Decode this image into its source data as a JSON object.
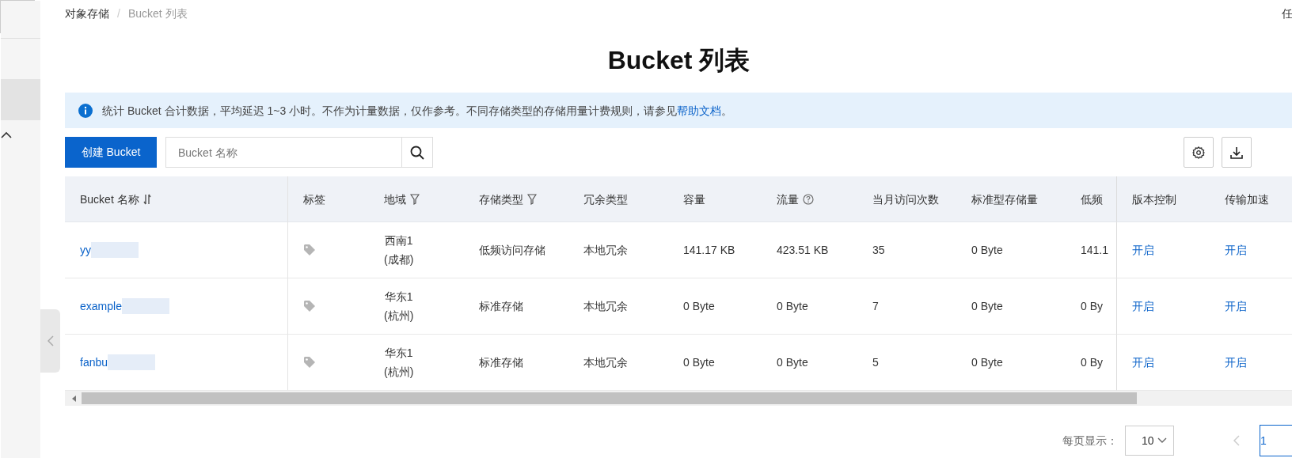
{
  "breadcrumb": {
    "items": [
      "对象存储",
      "Bucket 列表"
    ],
    "separator": "/"
  },
  "top_right_text": "任",
  "title": "Bucket 列表",
  "notice": {
    "text": "统计 Bucket 合计数据，平均延迟 1~3 小时。不作为计量数据，仅作参考。不同存储类型的存储用量计费规则，请参见",
    "link": "帮助文档",
    "suffix": "。"
  },
  "toolbar": {
    "create_button": "创建 Bucket",
    "search": {
      "placeholder": "Bucket 名称"
    }
  },
  "table": {
    "columns": [
      {
        "label": "Bucket 名称",
        "kind": "sortable"
      },
      {
        "label": "标签",
        "kind": "plain"
      },
      {
        "label": "地域",
        "kind": "filterable"
      },
      {
        "label": "存储类型",
        "kind": "filterable"
      },
      {
        "label": "冗余类型",
        "kind": "plain"
      },
      {
        "label": "容量",
        "kind": "plain"
      },
      {
        "label": "流量",
        "kind": "help"
      },
      {
        "label": "当月访问次数",
        "kind": "plain"
      },
      {
        "label": "标准型存储量",
        "kind": "plain"
      },
      {
        "label": "低频",
        "kind": "plain"
      },
      {
        "label": "版本控制",
        "kind": "plain"
      },
      {
        "label": "传输加速",
        "kind": "plain"
      }
    ],
    "rows": [
      {
        "name": "yy",
        "region": "西南1\n(成都)",
        "storage": "低频访问存储",
        "redundancy": "本地冗余",
        "capacity": "141.17 KB",
        "traffic": "423.51 KB",
        "visits": "35",
        "standard": "0 Byte",
        "low": "141.1",
        "versioning": "开启",
        "acceleration": "开启"
      },
      {
        "name": "example",
        "region": "华东1\n(杭州)",
        "storage": "标准存储",
        "redundancy": "本地冗余",
        "capacity": "0 Byte",
        "traffic": "0 Byte",
        "visits": "7",
        "standard": "0 Byte",
        "low": "0 By",
        "versioning": "开启",
        "acceleration": "开启"
      },
      {
        "name": "fanbu",
        "region": "华东1\n(杭州)",
        "storage": "标准存储",
        "redundancy": "本地冗余",
        "capacity": "0 Byte",
        "traffic": "0 Byte",
        "visits": "5",
        "standard": "0 Byte",
        "low": "0 By",
        "versioning": "开启",
        "acceleration": "开启"
      }
    ]
  },
  "pagination": {
    "page_size_label": "每页显示：",
    "page_size": "10",
    "pages": [
      {
        "label": "1",
        "selected": true
      }
    ]
  }
}
